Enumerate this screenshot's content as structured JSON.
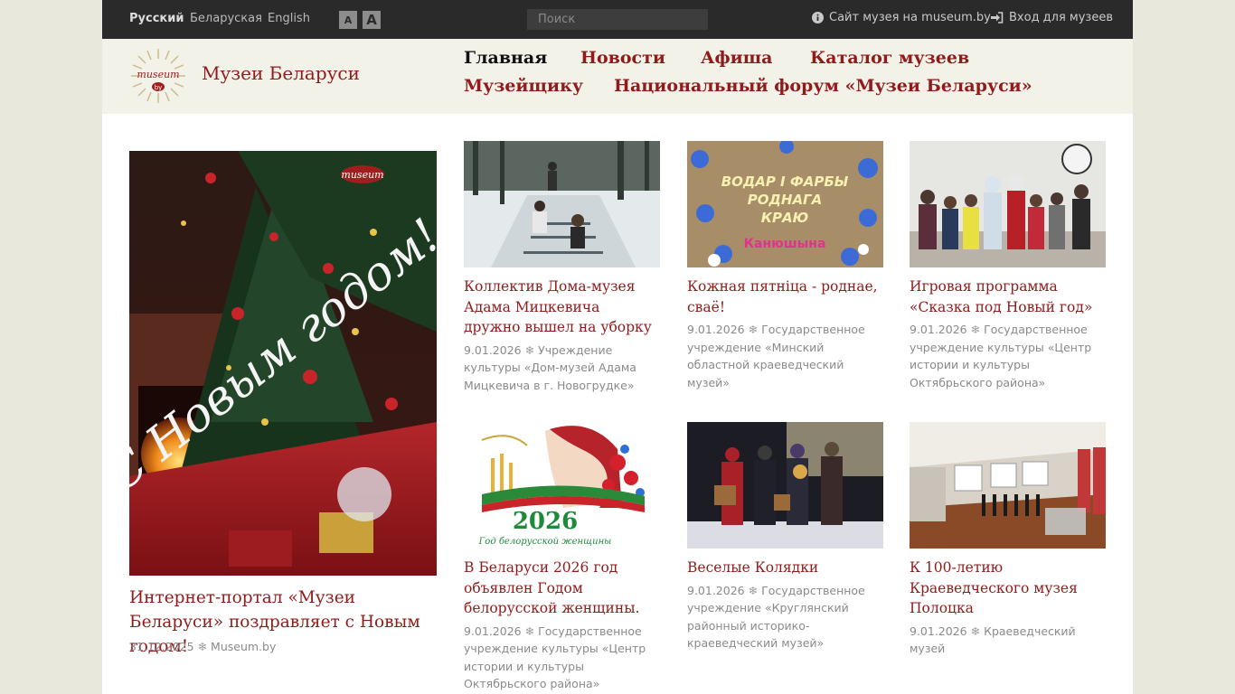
{
  "topbar": {
    "languages": [
      "Русский",
      "Беларуская",
      "English"
    ],
    "font_small": "A",
    "font_large": "A",
    "search_placeholder": "Поиск",
    "museum_site_link": "Сайт музея на museum.by",
    "login_link": "Вход для музеев"
  },
  "header": {
    "logo_text": "museum",
    "logo_sub": "by",
    "site_name": "Музеи Беларуси",
    "nav": [
      "Главная",
      "Новости",
      "Афиша",
      "Каталог музеев",
      "Музейщику",
      "Национальный форум «Музеи Беларуси»"
    ]
  },
  "featured": {
    "title": "Интернет-портал «Музеи Беларуси» поздравляет с Новым годом!",
    "date": "31.12.2025",
    "separator": "❄",
    "source": "Museum.by",
    "image_text": "С Новым годом!",
    "image_logo": "museum"
  },
  "news": [
    {
      "title": "Коллектив Дома-музея Адама Мицкевича дружно вышел на уборку",
      "date": "9.01.2026",
      "source": "Учреждение культуры «Дом-музей Адама Мицкевича в г. Новогрудке»"
    },
    {
      "title": "Кожная пятніца - роднае, сваё!",
      "date": "9.01.2026",
      "source": "Государственное учреждение «Минский областной краеведческий музей»",
      "image_text": [
        "ВОДАР І ФАРБЫ",
        "РОДНАГА",
        "КРАЮ"
      ],
      "image_caption": "Канюшына"
    },
    {
      "title": "Игровая программа «Сказка под Новый год»",
      "date": "9.01.2026",
      "source": "Государственное учреждение культуры «Центр истории и культуры Октябрьского района»"
    },
    {
      "title": "В Беларуси 2026 год объявлен Годом белорусской женщины.",
      "date": "9.01.2026",
      "source": "Государственное учреждение культуры «Центр истории и культуры Октябрьского района»",
      "image_text": "2026",
      "image_caption": "Год белорусской женщины"
    },
    {
      "title": "Веселые Колядки",
      "date": "9.01.2026",
      "source": "Государственное учреждение «Круглянский районный историко-краеведческий музей»"
    },
    {
      "title": "К 100-летию Краеведческого музея Полоцка",
      "date": "9.01.2026",
      "source": "Краеведческий музей"
    }
  ],
  "colors": {
    "accent": "#8f1b1b",
    "topbar": "#2a2a2a",
    "header_bg": "#f2f2e9",
    "page_bg": "#e8e8dc"
  }
}
